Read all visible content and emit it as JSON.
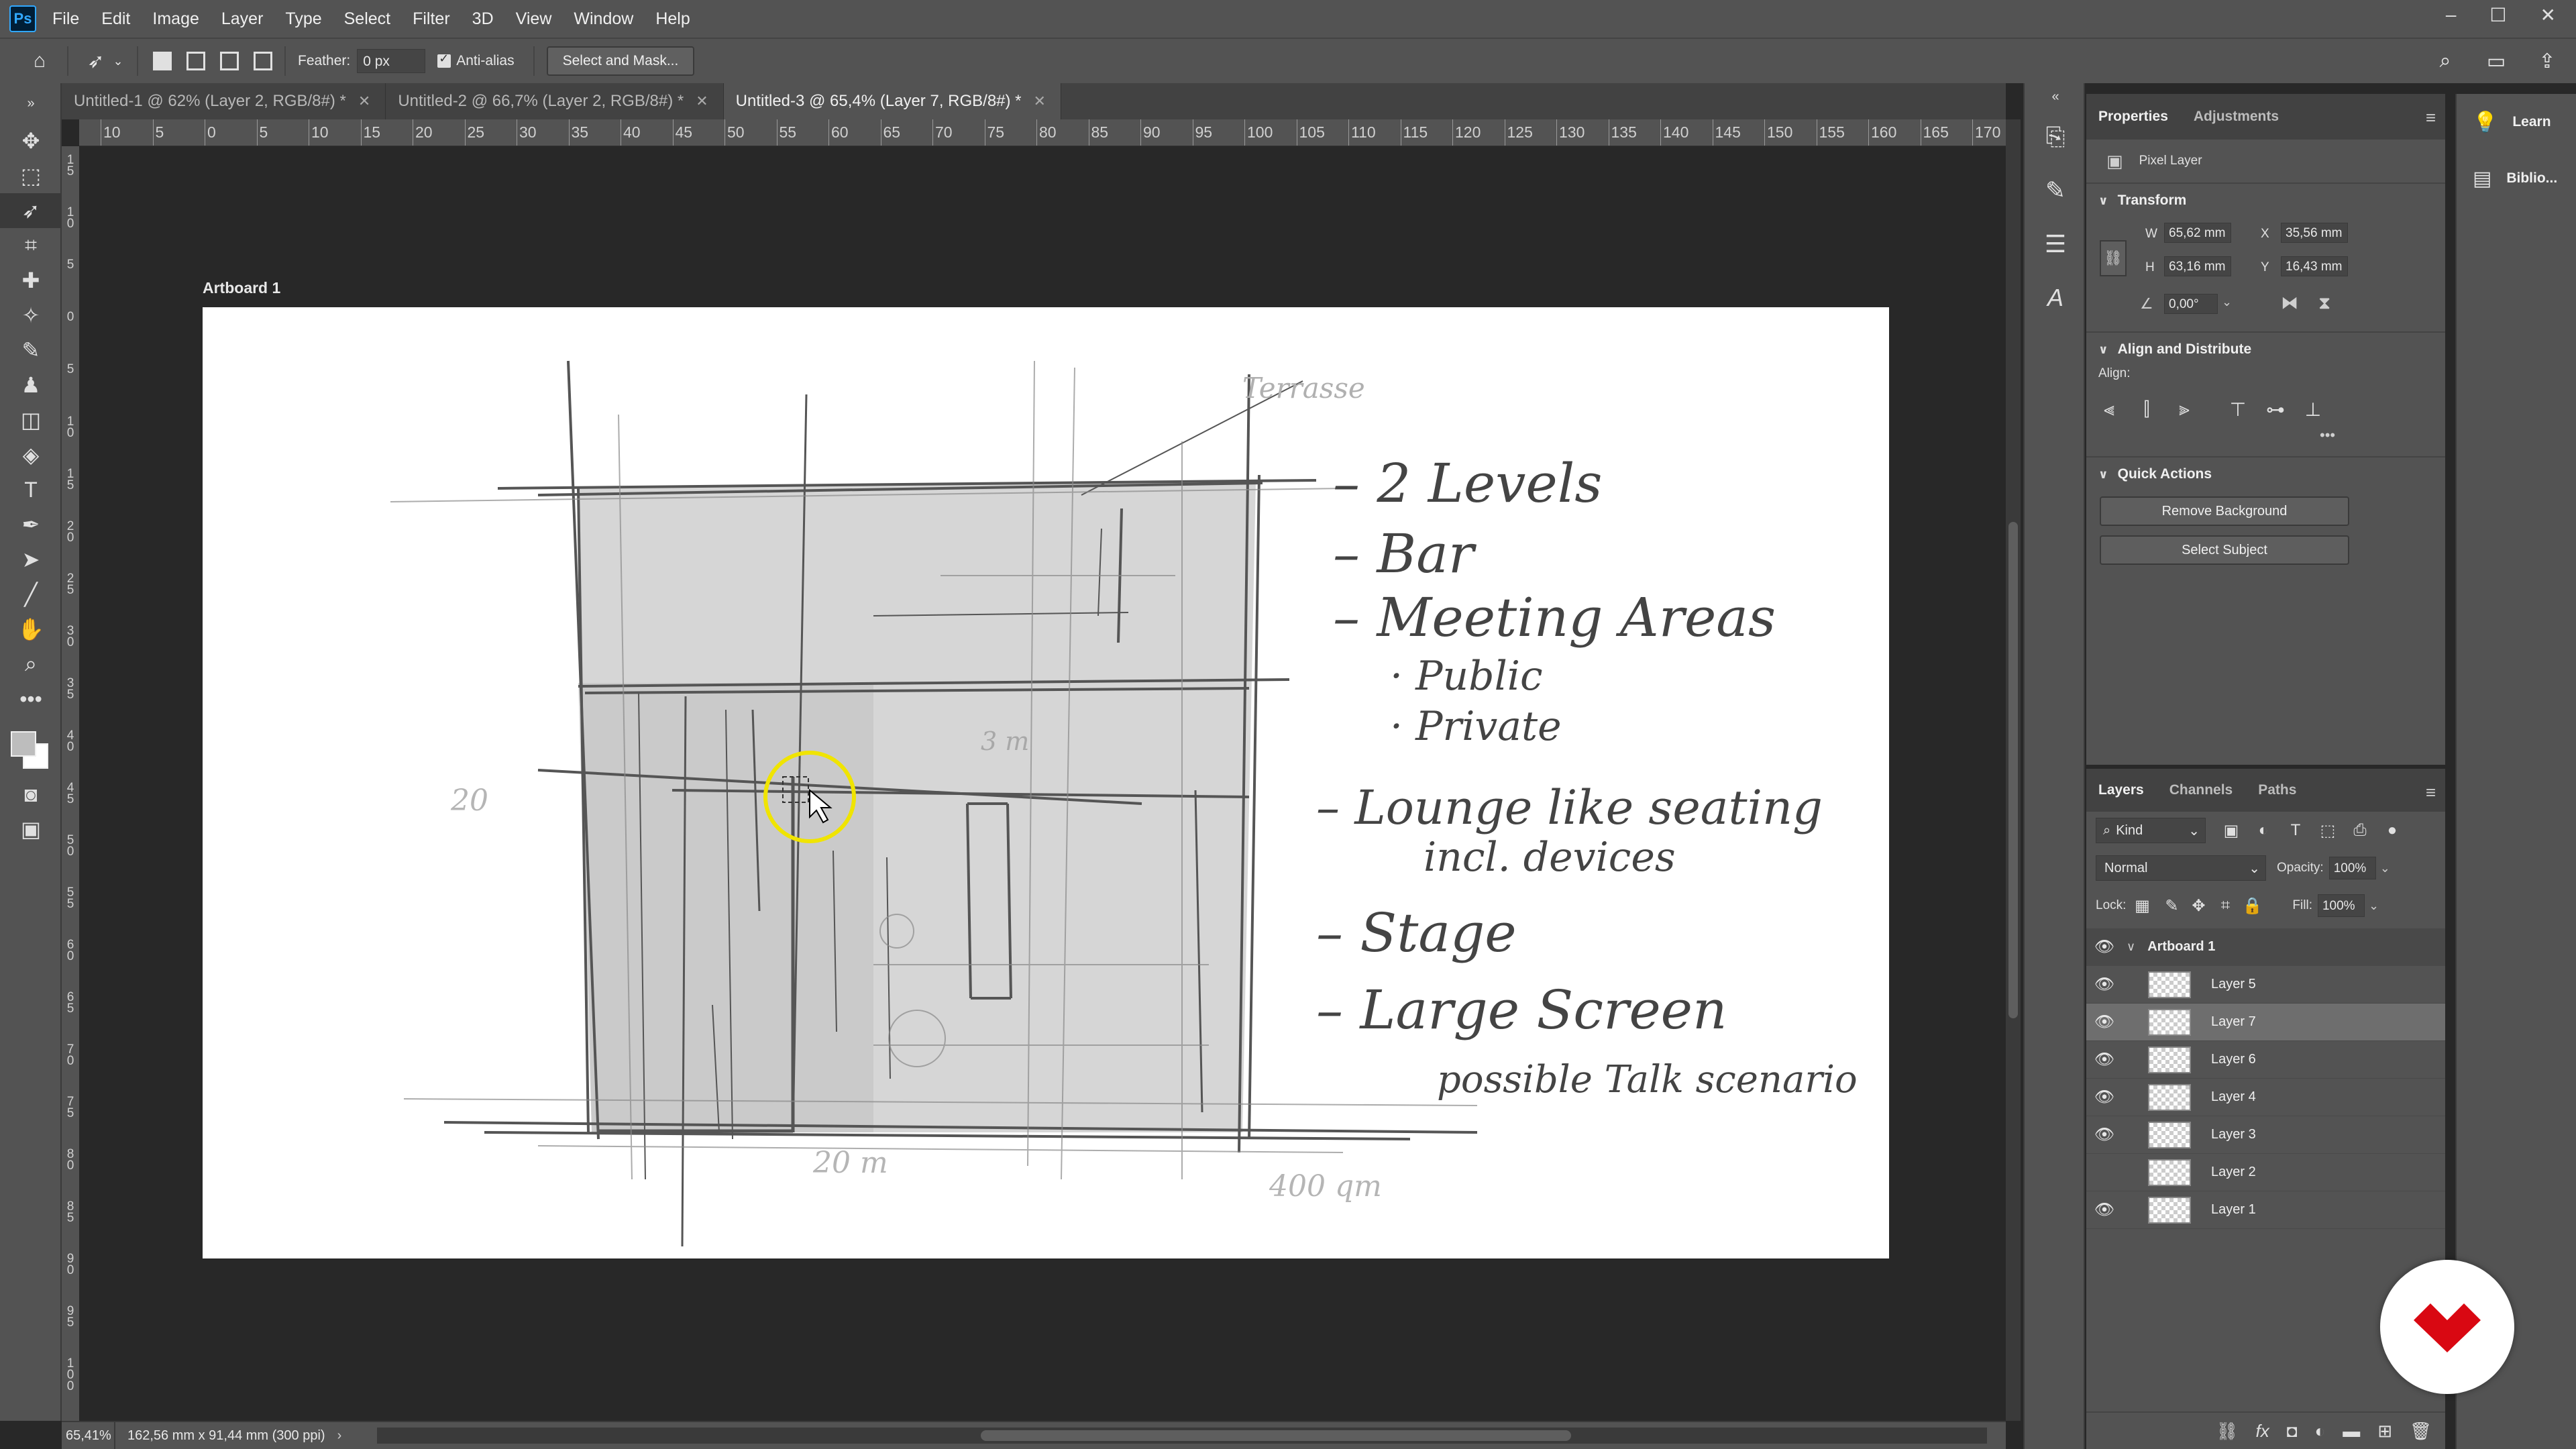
{
  "menubar": {
    "logo_text": "Ps",
    "items": [
      "File",
      "Edit",
      "Image",
      "Layer",
      "Type",
      "Select",
      "Filter",
      "3D",
      "View",
      "Window",
      "Help"
    ],
    "window_controls": [
      "–",
      "☐",
      "✕"
    ]
  },
  "options": {
    "feather_label": "Feather:",
    "feather_value": "0 px",
    "antialias_label": "Anti-alias",
    "select_mask_label": "Select and Mask..."
  },
  "tabs": [
    {
      "label": "Untitled-1 @ 62% (Layer 2, RGB/8#) *",
      "active": false
    },
    {
      "label": "Untitled-2 @ 66,7% (Layer 2, RGB/8#) *",
      "active": false
    },
    {
      "label": "Untitled-3 @ 65,4% (Layer 7, RGB/8#) *",
      "active": true
    }
  ],
  "ruler_h": [
    "10",
    "5",
    "0",
    "5",
    "10",
    "15",
    "20",
    "25",
    "30",
    "35",
    "40",
    "45",
    "50",
    "55",
    "60",
    "65",
    "70",
    "75",
    "80",
    "85",
    "90",
    "95",
    "100",
    "105",
    "110",
    "115",
    "120",
    "125",
    "130",
    "135",
    "140",
    "145",
    "150",
    "155",
    "160",
    "165",
    "170"
  ],
  "ruler_v": [
    "15",
    "10",
    "5",
    "0",
    "5",
    "10",
    "15",
    "20",
    "25",
    "30",
    "35",
    "40",
    "45",
    "50",
    "55",
    "60",
    "65",
    "70",
    "75",
    "80",
    "85",
    "90",
    "95",
    "100"
  ],
  "artboard": {
    "label": "Artboard 1",
    "notes": {
      "terrasse": "Terrasse",
      "n1": "– 2 Levels",
      "n2": "– Bar",
      "n3": "– Meeting Areas",
      "n3a": "· Public",
      "n3b": "· Private",
      "n4": "– Lounge like seating",
      "n4b": "incl. devices",
      "n5": "– Stage",
      "n6": "– Large Screen",
      "n6b": "possible Talk scenario",
      "dim_left": "20",
      "dim_bottom": "20 m",
      "area": "400 qm",
      "inner": "3 m"
    }
  },
  "properties": {
    "tabs": [
      "Properties",
      "Adjustments"
    ],
    "layer_type": "Pixel Layer",
    "transform_title": "Transform",
    "w_label": "W",
    "w_value": "65,62 mm",
    "h_label": "H",
    "h_value": "63,16 mm",
    "x_label": "X",
    "x_value": "35,56 mm",
    "y_label": "Y",
    "y_value": "16,43 mm",
    "angle_value": "0,00°",
    "align_title": "Align and Distribute",
    "align_label": "Align:",
    "more": "•••",
    "quick_title": "Quick Actions",
    "remove_bg": "Remove Background",
    "select_subject": "Select Subject"
  },
  "learn_panel": {
    "items": [
      "Learn",
      "Biblio..."
    ]
  },
  "layers": {
    "tabs": [
      "Layers",
      "Channels",
      "Paths"
    ],
    "kind": "Kind",
    "blend_mode": "Normal",
    "opacity_label": "Opacity:",
    "opacity_value": "100%",
    "lock_label": "Lock:",
    "fill_label": "Fill:",
    "fill_value": "100%",
    "group_name": "Artboard 1",
    "items": [
      {
        "name": "Layer 5",
        "visible": true,
        "selected": false
      },
      {
        "name": "Layer 7",
        "visible": true,
        "selected": true
      },
      {
        "name": "Layer 6",
        "visible": true,
        "selected": false
      },
      {
        "name": "Layer 4",
        "visible": true,
        "selected": false
      },
      {
        "name": "Layer 3",
        "visible": true,
        "selected": false
      },
      {
        "name": "Layer 2",
        "visible": false,
        "selected": false
      },
      {
        "name": "Layer 1",
        "visible": true,
        "selected": false
      }
    ]
  },
  "status": {
    "zoom": "65,41%",
    "doc_info": "162,56 mm x 91,44 mm (300 ppi)"
  },
  "colors": {
    "accent_logo": "#d90812",
    "cursor_highlight": "#f0e400",
    "panel_bg": "#535353",
    "canvas_bg": "#282828"
  }
}
